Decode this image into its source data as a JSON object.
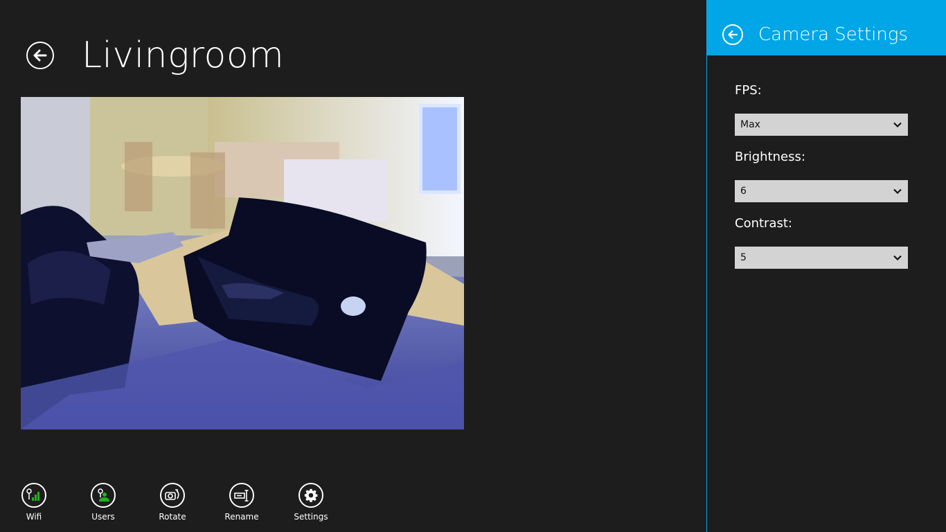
{
  "page": {
    "title": "Livingroom"
  },
  "app_bar": {
    "buttons": [
      {
        "label": "Wifi",
        "icon": "wifi-signal-icon"
      },
      {
        "label": "Users",
        "icon": "users-icon"
      },
      {
        "label": "Rotate",
        "icon": "rotate-camera-icon"
      },
      {
        "label": "Rename",
        "icon": "rename-icon"
      },
      {
        "label": "Settings",
        "icon": "gear-icon"
      }
    ]
  },
  "settings_panel": {
    "title": "Camera Settings",
    "fields": [
      {
        "label": "FPS:",
        "value": "Max"
      },
      {
        "label": "Brightness:",
        "value": "6"
      },
      {
        "label": "Contrast:",
        "value": "5"
      }
    ]
  },
  "colors": {
    "background": "#1d1d1d",
    "accent": "#00a6e6",
    "select_bg": "#d3d3d3",
    "icon_green": "#1db31d"
  }
}
